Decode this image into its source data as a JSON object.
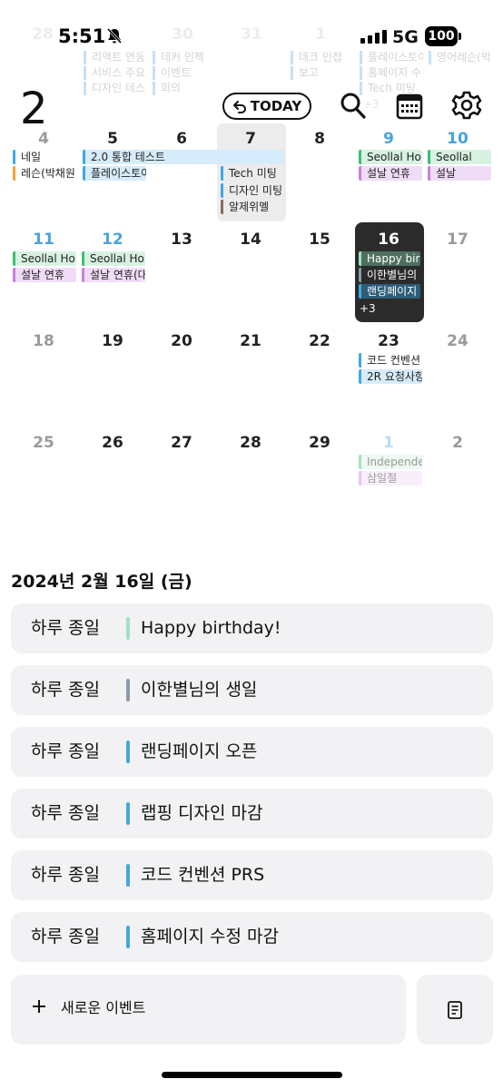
{
  "status_bar": {
    "time": "5:51",
    "network": "5G",
    "battery": "100"
  },
  "prev_month_ghost": {
    "numbers": [
      "28",
      "30",
      "31",
      "1"
    ],
    "events": [
      [
        "리액트 연동",
        "서비스 주요",
        "디자인 테스",
        "데커 인젝",
        "이벤트",
        "회의"
      ],
      [
        "데크 인접",
        "보고"
      ],
      [
        "플레이스토어",
        "홈페이지 수정",
        "Tech 미팅",
        "+3"
      ],
      [
        "영어레슨(박"
      ]
    ]
  },
  "header": {
    "month": "2",
    "today_label": "TODAY",
    "icons": [
      "undo-arrow-icon",
      "search-icon",
      "calendar-grid-icon",
      "gear-icon"
    ]
  },
  "calendar": {
    "rows": [
      {
        "days": [
          "4",
          "5",
          "6",
          "7",
          "8",
          "9",
          "10"
        ],
        "styles": [
          "dim",
          "normal",
          "normal",
          "normal",
          "normal",
          "holiday",
          "holiday"
        ]
      },
      {
        "days": [
          "11",
          "12",
          "13",
          "14",
          "15",
          "16",
          "17"
        ],
        "styles": [
          "holiday",
          "holiday",
          "normal",
          "normal",
          "normal",
          "normal",
          "dim"
        ]
      },
      {
        "days": [
          "18",
          "19",
          "20",
          "21",
          "22",
          "23",
          "24"
        ],
        "styles": [
          "dim",
          "normal",
          "normal",
          "normal",
          "normal",
          "normal",
          "dim"
        ]
      },
      {
        "days": [
          "25",
          "26",
          "27",
          "28",
          "29",
          "1",
          "2"
        ],
        "styles": [
          "dim",
          "normal",
          "normal",
          "normal",
          "normal",
          "dim-holiday",
          "dim"
        ]
      }
    ],
    "events": {
      "sun4_1": "네일",
      "sun4_2": "레슨(박채원",
      "span_integration": "2.0 통합 테스트",
      "mon5_playstore": "플레이스토어",
      "wed7_tech": "Tech 미팅",
      "wed7_design": "디자인 미팅",
      "wed7_alarm": "알제위멜",
      "fri9_seollal": "Seollal Ho",
      "fri9_holiday": "설날 연휴",
      "sat10_seollal": "Seollal",
      "sat10_holiday": "설날",
      "sun11_seollal": "Seollal Ho",
      "sun11_holiday": "설날 연휴",
      "mon12_seollal": "Seollal Ho",
      "mon12_holiday": "설날 연휴(대",
      "fri16_birthday": "Happy bir",
      "fri16_lee": "이한별님의 생",
      "fri16_landing": "랜딩페이지 오",
      "fri16_more": "+3",
      "fri23_code": "코드 컨벤션",
      "fri23_2r": "2R 요청사항",
      "fri1_indep": "Independe",
      "fri1_samil": "삼일절"
    }
  },
  "agenda": {
    "date_heading": "2024년 2월 16일 (금)",
    "items": [
      {
        "time": "하루 종일",
        "title": "Happy birthday!",
        "color": "#9fe0c0"
      },
      {
        "time": "하루 종일",
        "title": "이한별님의 생일",
        "color": "#8a9aaa"
      },
      {
        "time": "하루 종일",
        "title": "랜딩페이지 오픈",
        "color": "#3fa9e0"
      },
      {
        "time": "하루 종일",
        "title": "랩핑 디자인 마감",
        "color": "#3fa9e0"
      },
      {
        "time": "하루 종일",
        "title": "코드 컨벤션 PRS",
        "color": "#3fa9e0"
      },
      {
        "time": "하루 종일",
        "title": "홈페이지 수정 마감",
        "color": "#3fa9e0"
      }
    ],
    "new_event_label": "새로운 이벤트"
  }
}
